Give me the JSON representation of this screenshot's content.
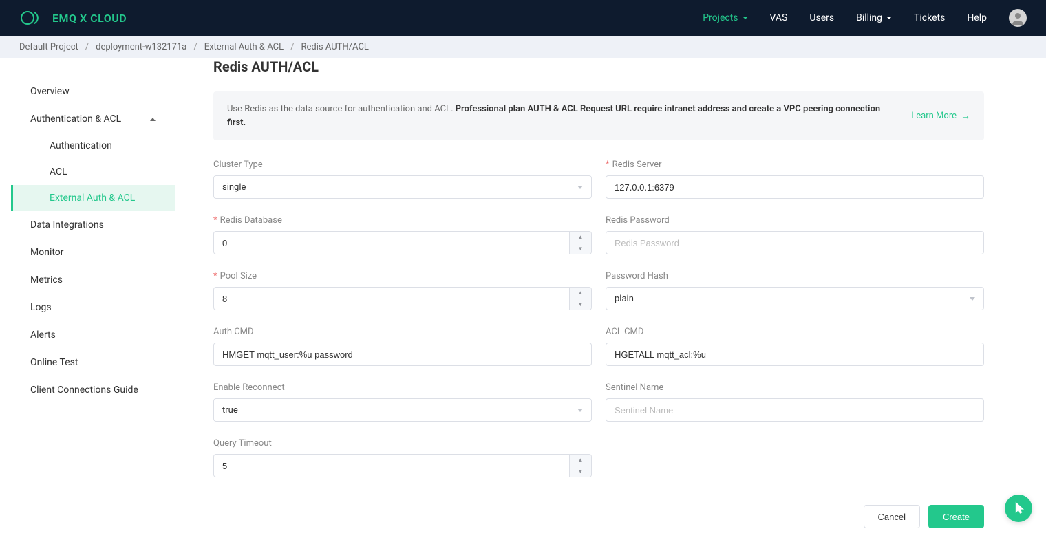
{
  "header": {
    "brand": "EMQ X CLOUD",
    "nav": {
      "projects": "Projects",
      "vas": "VAS",
      "users": "Users",
      "billing": "Billing",
      "tickets": "Tickets",
      "help": "Help"
    }
  },
  "breadcrumb": {
    "project": "Default Project",
    "deployment": "deployment-w132171a",
    "section": "External Auth & ACL",
    "page": "Redis AUTH/ACL"
  },
  "sidebar": {
    "overview": "Overview",
    "auth_acl": "Authentication & ACL",
    "authentication": "Authentication",
    "acl": "ACL",
    "external_auth_acl": "External Auth & ACL",
    "data_integrations": "Data Integrations",
    "monitor": "Monitor",
    "metrics": "Metrics",
    "logs": "Logs",
    "alerts": "Alerts",
    "online_test": "Online Test",
    "client_conn_guide": "Client Connections Guide"
  },
  "page": {
    "title": "Redis AUTH/ACL",
    "notice_prefix": "Use Redis as the data source for authentication and ACL. ",
    "notice_bold": "Professional plan AUTH & ACL Request URL require intranet address and create a VPC peering connection first.",
    "learn_more": "Learn More"
  },
  "form": {
    "cluster_type": {
      "label": "Cluster Type",
      "value": "single"
    },
    "redis_server": {
      "label": "Redis Server",
      "value": "127.0.0.1:6379"
    },
    "redis_database": {
      "label": "Redis Database",
      "value": "0"
    },
    "redis_password": {
      "label": "Redis Password",
      "value": "",
      "placeholder": "Redis Password"
    },
    "pool_size": {
      "label": "Pool Size",
      "value": "8"
    },
    "password_hash": {
      "label": "Password Hash",
      "value": "plain"
    },
    "auth_cmd": {
      "label": "Auth CMD",
      "value": "HMGET mqtt_user:%u password"
    },
    "acl_cmd": {
      "label": "ACL CMD",
      "value": "HGETALL mqtt_acl:%u"
    },
    "enable_reconnect": {
      "label": "Enable Reconnect",
      "value": "true"
    },
    "sentinel_name": {
      "label": "Sentinel Name",
      "value": "",
      "placeholder": "Sentinel Name"
    },
    "query_timeout": {
      "label": "Query Timeout",
      "value": "5"
    }
  },
  "actions": {
    "cancel": "Cancel",
    "create": "Create"
  }
}
